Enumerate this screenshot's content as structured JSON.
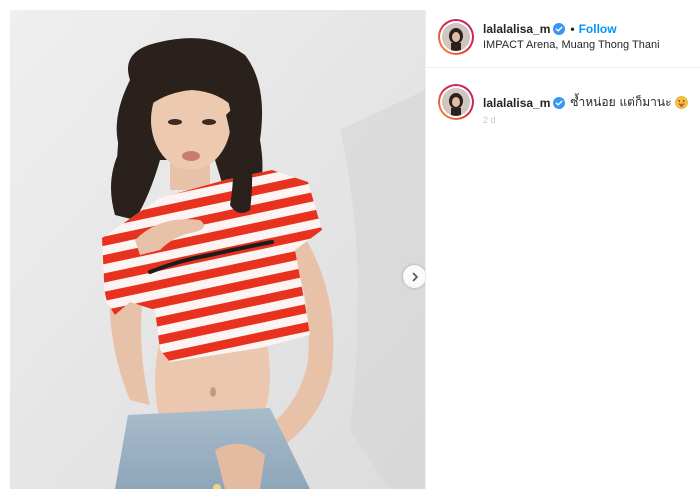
{
  "post": {
    "username": "lalalalisa_m",
    "separator": "•",
    "follow_label": "Follow",
    "location": "IMPACT Arena, Muang Thong Thani",
    "caption": "ซ้ำหน่อย แต่ก็มานะ",
    "timestamp": "2 d"
  },
  "icons": {
    "verified": "verified-badge-icon",
    "next": "chevron-right-icon",
    "emoji": "tongue-out-face-icon"
  },
  "colors": {
    "link_blue": "#0095f6",
    "verified_blue": "#3897f0",
    "story_ring": "#dc2743",
    "stripe_red": "#e8321f"
  }
}
